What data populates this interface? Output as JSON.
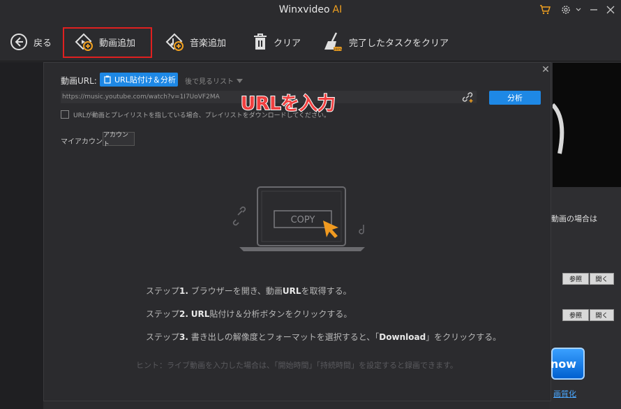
{
  "window": {
    "title": "Winxvideo",
    "title_ai": "AI"
  },
  "toolbar": {
    "back_label": "戻る",
    "add_video_label": "動画追加",
    "add_music_label": "音楽追加",
    "clear_label": "クリア",
    "clear_done_label": "完了したタスクをクリア"
  },
  "dialog": {
    "url_label": "動画URL:",
    "paste_analyze_label": "URL貼付け＆分析",
    "later_list_label": "後で見るリスト",
    "url_value": "https://music.youtube.com/watch?v=1I7UoVF2MA",
    "analyze_label": "分析",
    "overlay_label": "URLを入力",
    "playlist_checkbox_label": "URLが動画とプレイリストを指している場合、プレイリストをダウンロードしてください。",
    "account_label": "マイアカウント",
    "account_button": "アカウント",
    "illustration_copy": "COPY",
    "steps": [
      {
        "prefix": "ステップ",
        "num": "1.",
        "pre": " ブラウザーを開き、動画",
        "bold": "URL",
        "post": "を取得する。"
      },
      {
        "prefix": "ステップ",
        "num": "2.",
        "pre": " ",
        "bold": "URL",
        "post": "貼付け＆分析ボタンをクリックする。"
      },
      {
        "prefix": "ステップ",
        "num": "3.",
        "pre": " 書き出しの解像度とフォーマットを選択すると、「",
        "bold": "Download",
        "post": "」をクリックする。"
      }
    ],
    "hint": "ヒント：ライブ動画を入力した場合は、「開始時間」「持続時間」を設定すると録画できます。"
  },
  "background": {
    "right_text": "動画の場合は",
    "browse_label": "参照",
    "open_label": "開く",
    "now_label": "now",
    "link_label": "画質化"
  },
  "colors": {
    "accent": "#1e88e5",
    "highlight": "#e02020",
    "brand_ai": "#f0a020"
  }
}
